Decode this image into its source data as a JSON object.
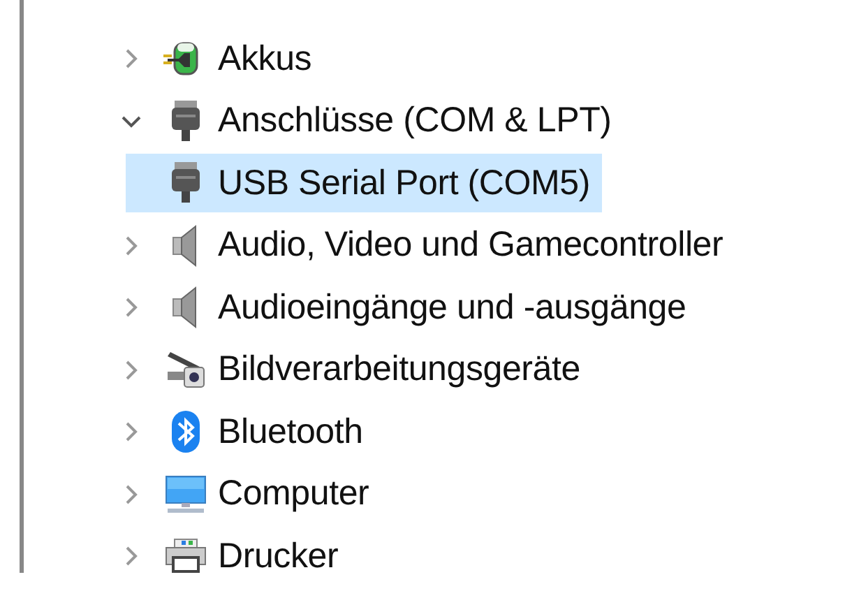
{
  "tree": [
    {
      "label": "Akkus",
      "kind": "battery",
      "expanded": false,
      "selected": false
    },
    {
      "label": "Anschlüsse (COM & LPT)",
      "kind": "port",
      "expanded": true,
      "selected": false,
      "children": [
        {
          "label": "USB Serial Port (COM5)",
          "kind": "port",
          "selected": true
        }
      ]
    },
    {
      "label": "Audio, Video und Gamecontroller",
      "kind": "speaker",
      "expanded": false,
      "selected": false
    },
    {
      "label": "Audioeingänge und -ausgänge",
      "kind": "speaker",
      "expanded": false,
      "selected": false
    },
    {
      "label": "Bildverarbeitungsgeräte",
      "kind": "camera",
      "expanded": false,
      "selected": false
    },
    {
      "label": "Bluetooth",
      "kind": "bluetooth",
      "expanded": false,
      "selected": false
    },
    {
      "label": "Computer",
      "kind": "monitor",
      "expanded": false,
      "selected": false
    },
    {
      "label": "Drucker",
      "kind": "printer",
      "expanded": false,
      "selected": false
    }
  ]
}
